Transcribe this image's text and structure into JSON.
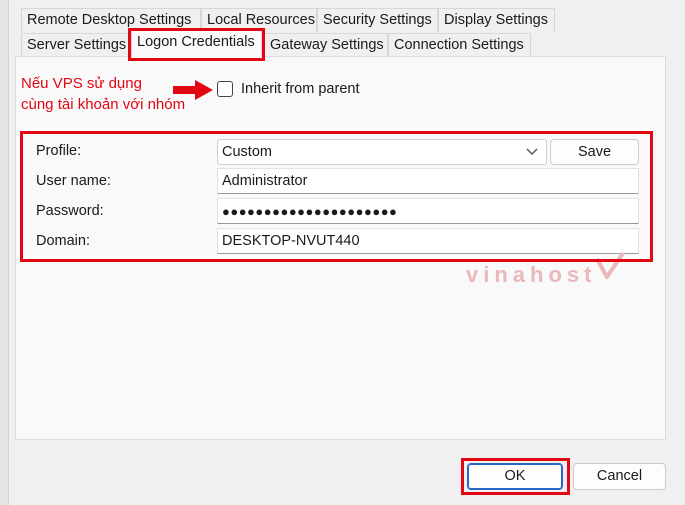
{
  "tabs_row1": [
    {
      "label": "Remote Desktop Settings"
    },
    {
      "label": "Local Resources"
    },
    {
      "label": "Security Settings"
    },
    {
      "label": "Display Settings"
    }
  ],
  "tabs_row2": [
    {
      "label": "Server Settings"
    },
    {
      "label": "Logon Credentials"
    },
    {
      "label": "Gateway Settings"
    },
    {
      "label": "Connection Settings"
    }
  ],
  "annotation": {
    "line1": "Nếu VPS sử dụng",
    "line2": "cùng tài khoản với nhóm",
    "color": "#e30613"
  },
  "inherit": {
    "label": "Inherit from parent",
    "checked": false
  },
  "form": {
    "profile_label": "Profile:",
    "profile_value": "Custom",
    "save_label": "Save",
    "username_label": "User name:",
    "username_value": "Administrator",
    "password_label": "Password:",
    "password_value": "●●●●●●●●●●●●●●●●●●●●●",
    "domain_label": "Domain:",
    "domain_value": "DESKTOP-NVUT440"
  },
  "watermark": "vinahost",
  "buttons": {
    "ok": "OK",
    "cancel": "Cancel"
  }
}
